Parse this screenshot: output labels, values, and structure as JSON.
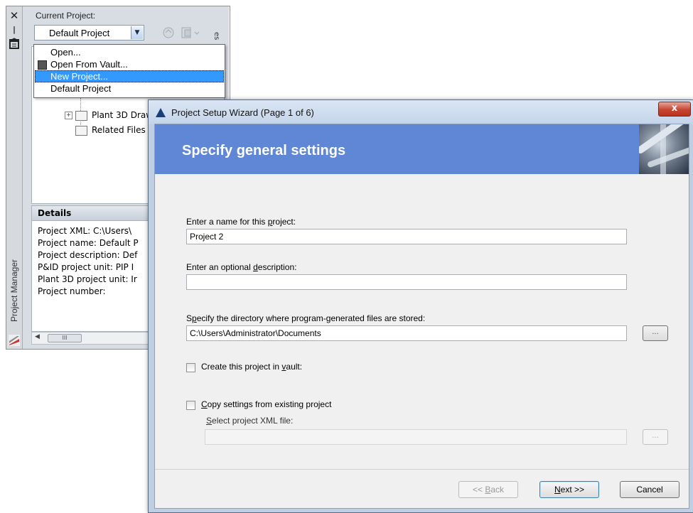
{
  "project_manager": {
    "vertical_title": "Project Manager",
    "current_project_label": "Current Project:",
    "selected_project": "Default Project",
    "side_tab_label": "es",
    "dropdown": [
      {
        "label": "Open..."
      },
      {
        "label": "Open From Vault..."
      },
      {
        "label": "New Project..."
      },
      {
        "label": "Default Project"
      }
    ],
    "tree": [
      {
        "label": "Plant 3D Draw"
      },
      {
        "label": "Related Files"
      }
    ],
    "details": {
      "title": "Details",
      "lines": [
        "Project XML: C:\\Users\\",
        "Project name: Default P",
        "Project description: Def",
        "P&ID project unit: PIP I",
        "Plant 3D project unit: Ir",
        "Project number:"
      ]
    },
    "scroll_thumb": "III"
  },
  "wizard": {
    "title": "Project Setup Wizard (Page 1 of 6)",
    "close_glyph": "x",
    "heading": "Specify general settings",
    "name_label_pre": "Enter a name for this ",
    "name_label_key": "p",
    "name_label_post": "roject:",
    "name_value": "Project 2",
    "desc_label_pre": "Enter an optional ",
    "desc_label_key": "d",
    "desc_label_post": "escription:",
    "desc_value": "",
    "dir_label_pre": "S",
    "dir_label_key": "p",
    "dir_label_post": "ecify the directory where program-generated files are stored:",
    "dir_value": "C:\\Users\\Administrator\\Documents",
    "browse_label": "...",
    "vault_label_pre": "Create this project in ",
    "vault_label_key": "v",
    "vault_label_post": "ault:",
    "copy_label_key": "C",
    "copy_label_post": "opy settings from existing project",
    "xml_label_key": "S",
    "xml_label_post": "elect project XML file:",
    "xml_value": "",
    "back_pre": "<< ",
    "back_key": "B",
    "back_post": "ack",
    "next_key": "N",
    "next_post": "ext >>",
    "cancel_label": "Cancel"
  }
}
